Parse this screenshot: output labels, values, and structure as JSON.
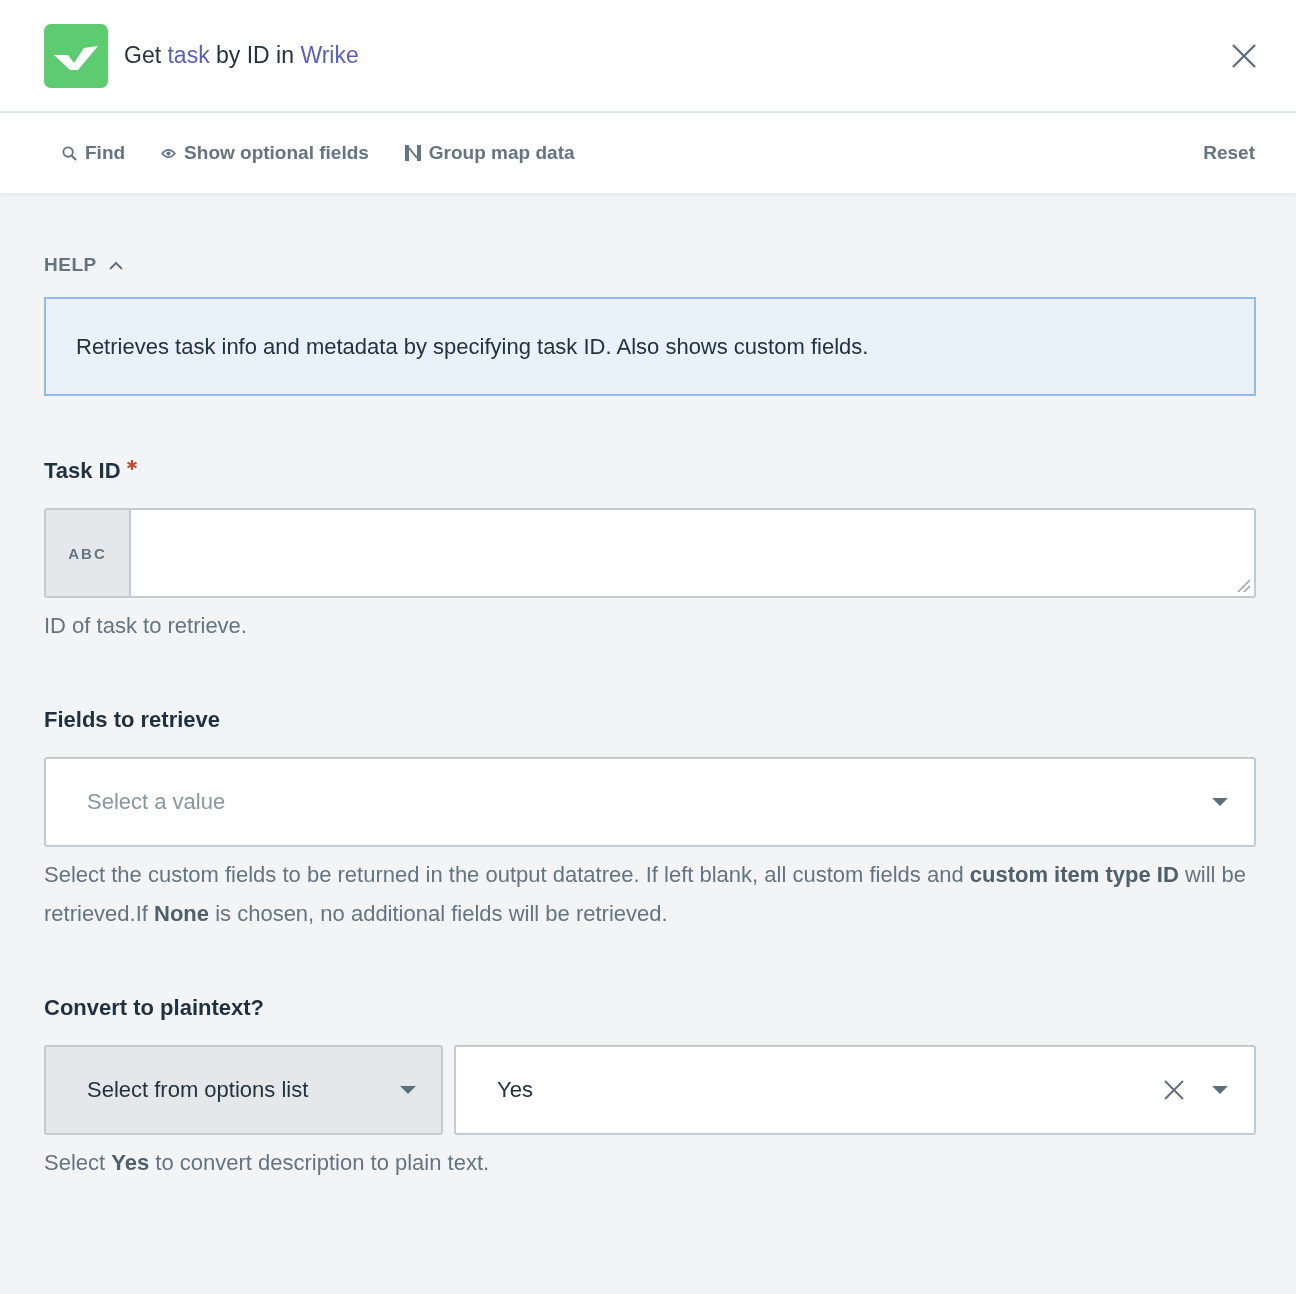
{
  "header": {
    "title": [
      {
        "text": "Get ",
        "kind": "plain"
      },
      {
        "text": "task",
        "kind": "highlight"
      },
      {
        "text": " by ID in ",
        "kind": "plain"
      },
      {
        "text": "Wrike",
        "kind": "highlight"
      }
    ]
  },
  "toolbar": {
    "find": "Find",
    "show_optional_fields": "Show optional fields",
    "group_map_data": "Group map data",
    "reset": "Reset"
  },
  "help": {
    "heading": "HELP",
    "expanded": true,
    "text": "Retrieves task info and metadata by specifying task ID. Also shows custom fields."
  },
  "fields": [
    {
      "kind": "text",
      "label": "Task ID",
      "required": true,
      "type_label": "ABC",
      "hint": "ID of task to retrieve."
    },
    {
      "kind": "select",
      "label": "Fields to retrieve",
      "required": false,
      "placeholder": "Select a value",
      "hint": "Select the custom fields to be returned in the output datatree. If left blank, all custom fields and **custom item type ID** will be retrieved.If **None** is chosen, no additional fields will be retrieved."
    },
    {
      "kind": "mode_select",
      "label": "Convert to plaintext?",
      "required": false,
      "mode": "Select from options list",
      "value": "Yes",
      "hint": "Select **Yes** to convert description to plain text."
    }
  ]
}
